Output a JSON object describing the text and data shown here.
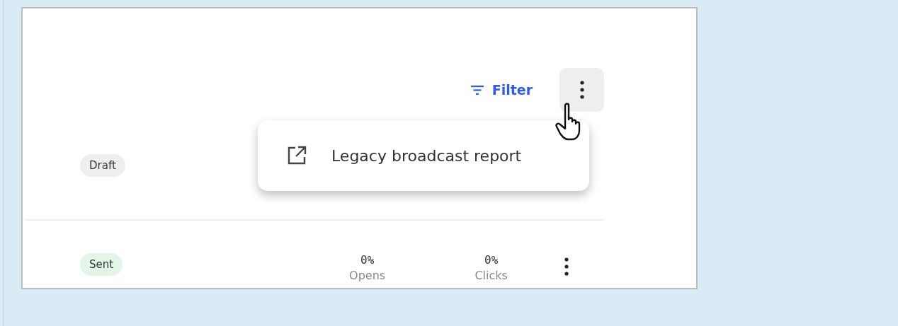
{
  "toolbar": {
    "filter_label": "Filter"
  },
  "menu": {
    "items": [
      {
        "label": "Legacy broadcast report"
      }
    ]
  },
  "rows": [
    {
      "status": "Draft",
      "kind": "draft"
    },
    {
      "status": "Sent",
      "kind": "sent",
      "stats": [
        {
          "value": "0%",
          "label": "Opens"
        },
        {
          "value": "0%",
          "label": "Clicks"
        }
      ]
    }
  ]
}
